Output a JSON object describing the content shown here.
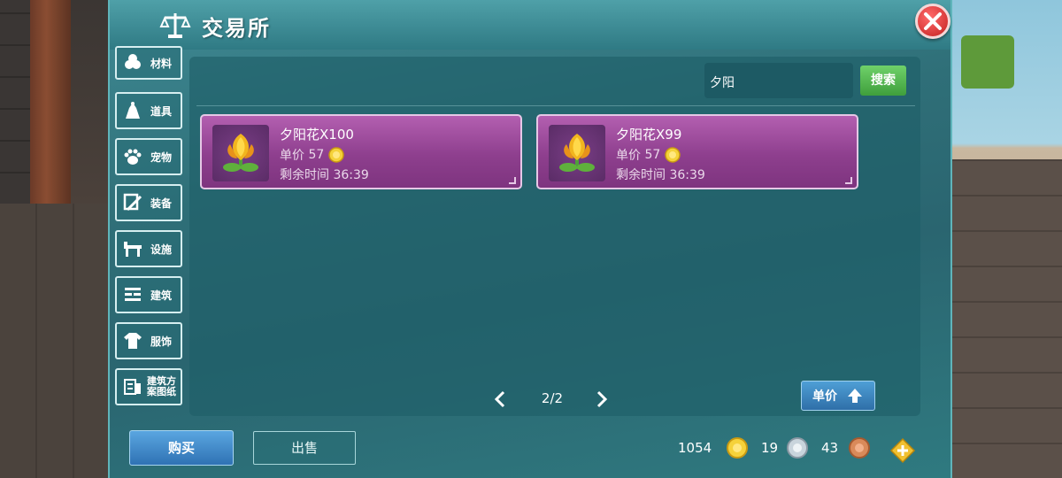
{
  "header": {
    "title": "交易所"
  },
  "sidebar": {
    "items": [
      {
        "label": "材料"
      },
      {
        "label": "道具"
      },
      {
        "label": "宠物"
      },
      {
        "label": "装备"
      },
      {
        "label": "设施"
      },
      {
        "label": "建筑"
      },
      {
        "label": "服饰"
      },
      {
        "label": "建筑方案图纸"
      }
    ]
  },
  "search": {
    "value": "夕阳",
    "button_label": "搜索"
  },
  "listings": [
    {
      "name": "夕阳花X100",
      "price_label": "单价",
      "price": "57",
      "time_label": "剩余时间",
      "time": "36:39"
    },
    {
      "name": "夕阳花X99",
      "price_label": "单价",
      "price": "57",
      "time_label": "剩余时间",
      "time": "36:39"
    }
  ],
  "pager": {
    "text": "2/2"
  },
  "sort": {
    "label": "单价"
  },
  "footer": {
    "buy_label": "购买",
    "sell_label": "出售",
    "gold": "1054",
    "silver": "19",
    "bronze": "43"
  },
  "colors": {
    "panel": "#2f6f78",
    "card": "#9b4b9a",
    "search_button": "#4fb84c",
    "buy_button": "#3f86c8",
    "close_button": "#d93030"
  }
}
